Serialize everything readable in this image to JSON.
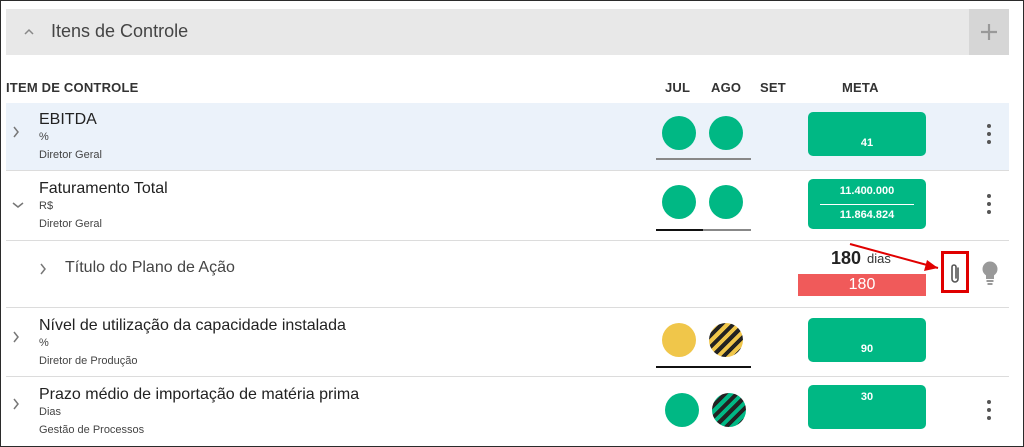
{
  "panel": {
    "title": "Itens de Controle"
  },
  "columns": {
    "item": "ITEM DE CONTROLE",
    "months": [
      "JUL",
      "AGO",
      "SET"
    ],
    "meta": "META"
  },
  "rows": [
    {
      "name": "EBITDA",
      "unit": "%",
      "owner": "Diretor Geral",
      "meta": "41",
      "status": [
        "green",
        "green"
      ]
    },
    {
      "name": "Faturamento Total",
      "unit": "R$",
      "owner": "Diretor Geral",
      "meta_top": "11.400.000",
      "meta_bottom": "11.864.824",
      "status": [
        "green",
        "green"
      ]
    },
    {
      "name": "Nível de utilização da capacidade instalada",
      "unit": "%",
      "owner": "Diretor de Produção",
      "meta": "90",
      "status": [
        "yellow",
        "hatched-yellow"
      ]
    },
    {
      "name": "Prazo médio de importação de matéria prima",
      "unit": "Dias",
      "owner": "Gestão de Processos",
      "meta": "30",
      "status": [
        "green",
        "hatched-green"
      ]
    }
  ],
  "action_plan": {
    "title": "Título do Plano de Ação",
    "days_value": "180",
    "days_label": "dias",
    "overdue_value": "180"
  },
  "colors": {
    "green": "#00b884",
    "yellow": "#f0c64a",
    "red": "#f05a5a",
    "highlight_row": "#ebf2fa",
    "annotation": "#e00000"
  }
}
